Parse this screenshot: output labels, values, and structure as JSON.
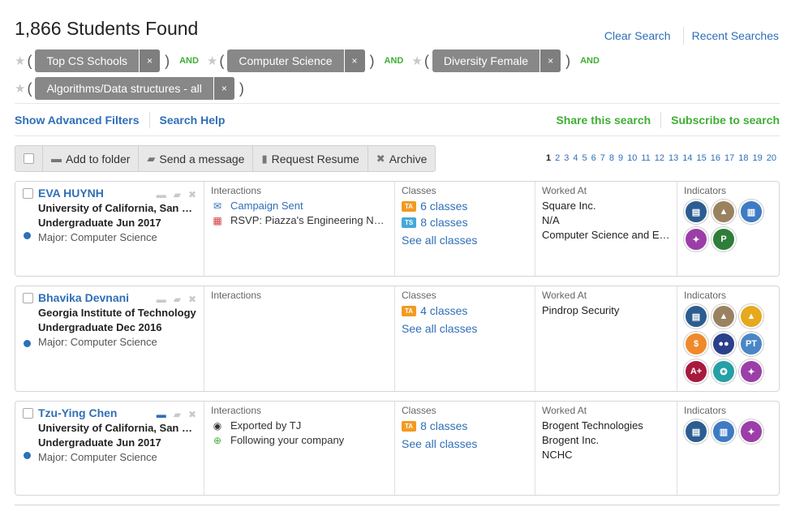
{
  "header": {
    "title": "1,866 Students Found",
    "clear_search": "Clear Search",
    "recent_searches": "Recent Searches"
  },
  "filters": {
    "chips": [
      "Top CS Schools",
      "Computer Science",
      "Diversity Female",
      "Algorithms/Data structures - all"
    ],
    "and_label": "AND",
    "remove_glyph": "×",
    "star_glyph": "★",
    "open_paren": "(",
    "close_paren": ")"
  },
  "subbar": {
    "advanced": "Show Advanced Filters",
    "help": "Search Help",
    "share": "Share this search",
    "subscribe": "Subscribe to search"
  },
  "toolbar": {
    "add_folder": "Add to folder",
    "send_message": "Send a message",
    "request_resume": "Request Resume",
    "archive": "Archive"
  },
  "pagination": {
    "current": "1",
    "pages": [
      "2",
      "3",
      "4",
      "5",
      "6",
      "7",
      "8",
      "9",
      "10",
      "11",
      "12",
      "13",
      "14",
      "15",
      "16",
      "17",
      "18",
      "19",
      "20"
    ]
  },
  "columns": {
    "interactions": "Interactions",
    "classes": "Classes",
    "worked_at": "Worked At",
    "indicators": "Indicators"
  },
  "students": [
    {
      "name": "EVA HUYNH",
      "school": "University of California, San Diego",
      "degree": "Undergraduate Jun 2017",
      "major": "Major: Computer Science",
      "interactions": [
        {
          "icon": "envelope-icon",
          "text": "Campaign Sent",
          "link": true
        },
        {
          "icon": "calendar-icon",
          "text": "RSVP: Piazza's Engineering Night",
          "link": false
        }
      ],
      "classes": [
        {
          "badge": "TA",
          "text": "6 classes"
        },
        {
          "badge": "TS",
          "text": "8 classes"
        }
      ],
      "see_all": "See all classes",
      "worked_at": [
        "Square Inc.",
        "N/A",
        "Computer Science and Engineering"
      ],
      "indicators": [
        {
          "name": "document-indicator-icon",
          "color": "#2b5d91",
          "glyph": "▤"
        },
        {
          "name": "mountain-indicator-icon",
          "color": "#9a8261",
          "glyph": "▲"
        },
        {
          "name": "binder-indicator-icon",
          "color": "#3e7bc4",
          "glyph": "▥"
        },
        {
          "name": "person-indicator-icon",
          "color": "#9b3ea8",
          "glyph": "✦"
        },
        {
          "name": "parking-indicator-icon",
          "color": "#2f7d3a",
          "glyph": "P"
        }
      ]
    },
    {
      "name": "Bhavika Devnani",
      "school": "Georgia Institute of Technology",
      "degree": "Undergraduate Dec 2016",
      "major": "Major: Computer Science",
      "interactions": [],
      "classes": [
        {
          "badge": "TA",
          "text": "4 classes"
        }
      ],
      "see_all": "See all classes",
      "worked_at": [
        "Pindrop Security"
      ],
      "indicators": [
        {
          "name": "document-indicator-icon",
          "color": "#2b5d91",
          "glyph": "▤"
        },
        {
          "name": "mountain-indicator-icon",
          "color": "#9a8261",
          "glyph": "▲"
        },
        {
          "name": "mountain-gold-indicator-icon",
          "color": "#e6a91e",
          "glyph": "▲"
        },
        {
          "name": "dollar-indicator-icon",
          "color": "#f0892a",
          "glyph": "$"
        },
        {
          "name": "group-indicator-icon",
          "color": "#2b3f8a",
          "glyph": "●●"
        },
        {
          "name": "pt-indicator-icon",
          "color": "#4a86c6",
          "glyph": "PT"
        },
        {
          "name": "a-plus-indicator-icon",
          "color": "#a8193e",
          "glyph": "A+"
        },
        {
          "name": "ribbon-indicator-icon",
          "color": "#25a1a6",
          "glyph": "✪"
        },
        {
          "name": "person-indicator-icon",
          "color": "#9b3ea8",
          "glyph": "✦"
        }
      ]
    },
    {
      "name": "Tzu-Ying Chen",
      "school": "University of California, San Diego",
      "degree": "Undergraduate Jun 2017",
      "major": "Major: Computer Science",
      "interactions": [
        {
          "icon": "eye-icon",
          "text": "Exported by TJ",
          "link": false
        },
        {
          "icon": "plus-circle-icon",
          "text": "Following your company",
          "link": false
        }
      ],
      "classes": [
        {
          "badge": "TA",
          "text": "8 classes"
        }
      ],
      "see_all": "See all classes",
      "worked_at": [
        "Brogent Technologies",
        "Brogent Inc.",
        "NCHC"
      ],
      "indicators": [
        {
          "name": "document-indicator-icon",
          "color": "#2b5d91",
          "glyph": "▤"
        },
        {
          "name": "binder-indicator-icon",
          "color": "#3e7bc4",
          "glyph": "▥"
        },
        {
          "name": "person-indicator-icon",
          "color": "#9b3ea8",
          "glyph": "✦"
        }
      ]
    }
  ]
}
